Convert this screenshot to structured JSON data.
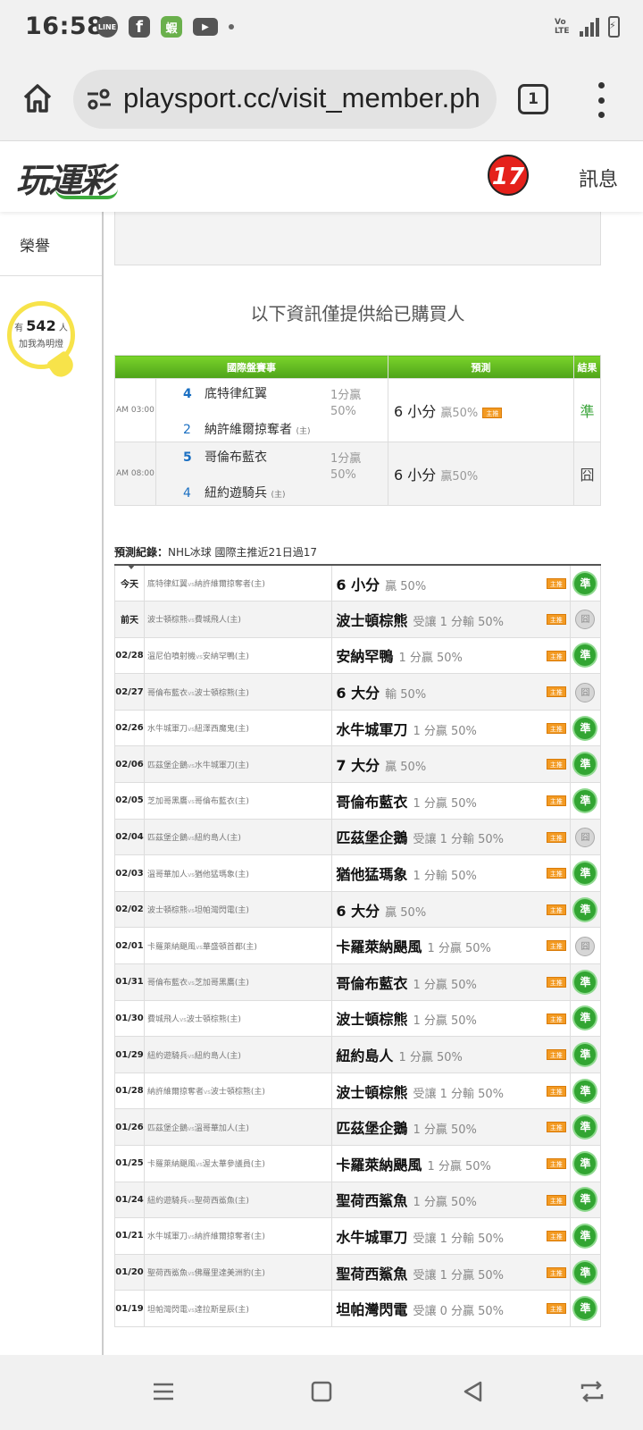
{
  "status_bar": {
    "time": "16:58"
  },
  "browser": {
    "url": "playsport.cc/visit_member.ph",
    "tab_count": "1"
  },
  "site": {
    "logo": "玩運彩",
    "badge": "17",
    "message_link": "訊息"
  },
  "sidebar": {
    "honor_label": "榮譽",
    "bulb_prefix": "有",
    "bulb_count": "542",
    "bulb_suffix": "人",
    "bulb_sub": "加我為明燈"
  },
  "main": {
    "buyer_note": "以下資訊僅提供給已購買人",
    "headers": {
      "match": "國際盤賽事",
      "prediction": "預測",
      "result": "結果"
    },
    "predictions": [
      {
        "time": "AM 03:00",
        "team1_rank": "4",
        "team1": "底特律紅翼",
        "team2_rank": "2",
        "team2": "納許維爾掠奪者",
        "host": "(主)",
        "odds1": "1分贏",
        "odds2": "50%",
        "pick": "6 小分",
        "pick_sub": "贏50%",
        "tag": "主推",
        "result": "準"
      },
      {
        "time": "AM 08:00",
        "team1_rank": "5",
        "team1": "哥倫布藍衣",
        "team2_rank": "4",
        "team2": "紐約遊騎兵",
        "host": "(主)",
        "odds1": "1分贏",
        "odds2": "50%",
        "pick": "6 小分",
        "pick_sub": "贏50%",
        "tag": "",
        "result": "囧"
      }
    ],
    "record_title_label": "預測紀錄：",
    "record_title": "NHL冰球 國際主推近21日過17",
    "records": [
      {
        "date": "今天",
        "away": "底特律紅翼",
        "vs": "vs",
        "home": "納許維爾掠奪者(主)",
        "team": "6 小分",
        "desc": "贏 50%",
        "tag": "主推",
        "result": "準"
      },
      {
        "date": "前天",
        "away": "波士頓棕熊",
        "vs": "vs",
        "home": "費城飛人(主)",
        "team": "波士頓棕熊",
        "desc": "受讓 1 分輸 50%",
        "tag": "主推",
        "result": "囧"
      },
      {
        "date": "02/28",
        "away": "溫尼伯噴射機",
        "vs": "vs",
        "home": "安納罕鴨(主)",
        "team": "安納罕鴨",
        "desc": "1 分贏 50%",
        "tag": "主推",
        "result": "準"
      },
      {
        "date": "02/27",
        "away": "哥倫布藍衣",
        "vs": "vs",
        "home": "波士頓棕熊(主)",
        "team": "6 大分",
        "desc": "輸 50%",
        "tag": "主推",
        "result": "囧"
      },
      {
        "date": "02/26",
        "away": "水牛城軍刀",
        "vs": "vs",
        "home": "紐澤西魔鬼(主)",
        "team": "水牛城軍刀",
        "desc": "1 分贏 50%",
        "tag": "主推",
        "result": "準"
      },
      {
        "date": "02/06",
        "away": "匹茲堡企鵝",
        "vs": "vs",
        "home": "水牛城軍刀(主)",
        "team": "7 大分",
        "desc": "贏 50%",
        "tag": "主推",
        "result": "準"
      },
      {
        "date": "02/05",
        "away": "芝加哥黑鷹",
        "vs": "vs",
        "home": "哥倫布藍衣(主)",
        "team": "哥倫布藍衣",
        "desc": "1 分贏 50%",
        "tag": "主推",
        "result": "準"
      },
      {
        "date": "02/04",
        "away": "匹茲堡企鵝",
        "vs": "vs",
        "home": "紐約島人(主)",
        "team": "匹茲堡企鵝",
        "desc": "受讓 1 分輸 50%",
        "tag": "主推",
        "result": "囧"
      },
      {
        "date": "02/03",
        "away": "溫哥華加人",
        "vs": "vs",
        "home": "猶他猛瑪象(主)",
        "team": "猶他猛瑪象",
        "desc": "1 分輸 50%",
        "tag": "主推",
        "result": "準"
      },
      {
        "date": "02/02",
        "away": "波士頓棕熊",
        "vs": "vs",
        "home": "坦帕灣閃電(主)",
        "team": "6 大分",
        "desc": "贏 50%",
        "tag": "主推",
        "result": "準"
      },
      {
        "date": "02/01",
        "away": "卡羅萊納颶風",
        "vs": "vs",
        "home": "華盛頓首都(主)",
        "team": "卡羅萊納颶風",
        "desc": "1 分贏 50%",
        "tag": "主推",
        "result": "囧"
      },
      {
        "date": "01/31",
        "away": "哥倫布藍衣",
        "vs": "vs",
        "home": "芝加哥黑鷹(主)",
        "team": "哥倫布藍衣",
        "desc": "1 分贏 50%",
        "tag": "主推",
        "result": "準"
      },
      {
        "date": "01/30",
        "away": "費城飛人",
        "vs": "vs",
        "home": "波士頓棕熊(主)",
        "team": "波士頓棕熊",
        "desc": "1 分贏 50%",
        "tag": "主推",
        "result": "準"
      },
      {
        "date": "01/29",
        "away": "紐約遊騎兵",
        "vs": "vs",
        "home": "紐約島人(主)",
        "team": "紐約島人",
        "desc": "1 分贏 50%",
        "tag": "主推",
        "result": "準"
      },
      {
        "date": "01/28",
        "away": "納許維爾掠奪者",
        "vs": "vs",
        "home": "波士頓棕熊(主)",
        "team": "波士頓棕熊",
        "desc": "受讓 1 分輸 50%",
        "tag": "主推",
        "result": "準"
      },
      {
        "date": "01/26",
        "away": "匹茲堡企鵝",
        "vs": "vs",
        "home": "溫哥華加人(主)",
        "team": "匹茲堡企鵝",
        "desc": "1 分贏 50%",
        "tag": "主推",
        "result": "準"
      },
      {
        "date": "01/25",
        "away": "卡羅萊納颶風",
        "vs": "vs",
        "home": "渥太華參議員(主)",
        "team": "卡羅萊納颶風",
        "desc": "1 分贏 50%",
        "tag": "主推",
        "result": "準"
      },
      {
        "date": "01/24",
        "away": "紐約遊騎兵",
        "vs": "vs",
        "home": "聖荷西鯊魚(主)",
        "team": "聖荷西鯊魚",
        "desc": "1 分贏 50%",
        "tag": "主推",
        "result": "準"
      },
      {
        "date": "01/21",
        "away": "水牛城軍刀",
        "vs": "vs",
        "home": "納許維爾掠奪者(主)",
        "team": "水牛城軍刀",
        "desc": "受讓 1 分輸 50%",
        "tag": "主推",
        "result": "準"
      },
      {
        "date": "01/20",
        "away": "聖荷西鯊魚",
        "vs": "vs",
        "home": "佛羅里達美洲豹(主)",
        "team": "聖荷西鯊魚",
        "desc": "受讓 1 分贏 50%",
        "tag": "主推",
        "result": "準"
      },
      {
        "date": "01/19",
        "away": "坦帕灣閃電",
        "vs": "vs",
        "home": "達拉斯星辰(主)",
        "team": "坦帕灣閃電",
        "desc": "受讓 0 分贏 50%",
        "tag": "主推",
        "result": "準"
      }
    ]
  },
  "colors": {
    "green": "#4ea31a",
    "win": "#32a532",
    "tag": "#f39a22",
    "rank": "#1a6fc2"
  },
  "icons": [
    "home-icon",
    "tune-icon",
    "tabs-icon",
    "more-vert-icon",
    "line-icon",
    "facebook-icon",
    "shop-icon",
    "youtube-icon",
    "signal-icon",
    "battery-icon",
    "nav-menu-icon",
    "nav-home-icon",
    "nav-back-icon",
    "nav-rotate-icon"
  ]
}
